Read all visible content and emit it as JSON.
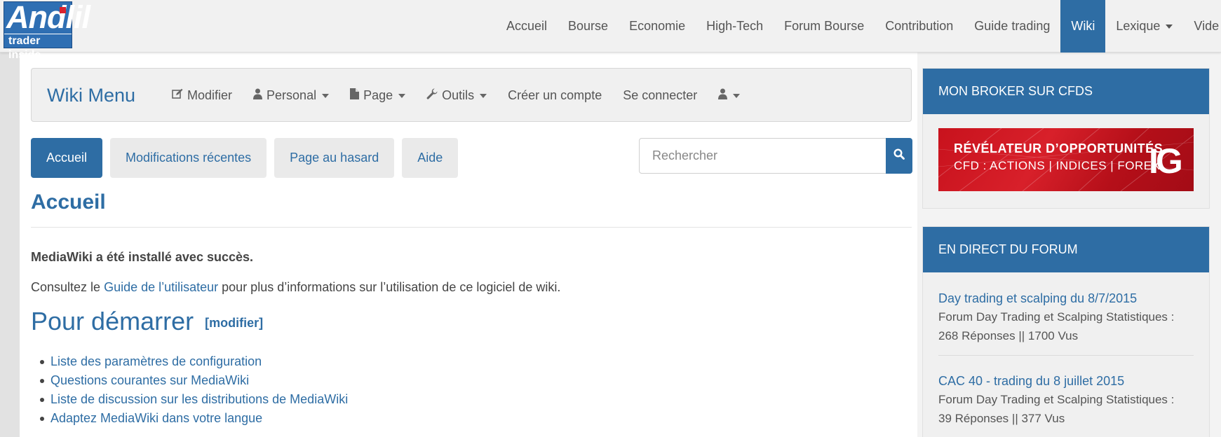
{
  "logo": {
    "main": "Andlil",
    "sub": "trader inside"
  },
  "topnav": {
    "items": [
      "Accueil",
      "Bourse",
      "Economie",
      "High-Tech",
      "Forum Bourse",
      "Contribution",
      "Guide trading",
      "Wiki",
      "Lexique",
      "Vide"
    ]
  },
  "wiki_menu": {
    "brand": "Wiki Menu",
    "modifier": "Modifier",
    "personal": "Personal",
    "page": "Page",
    "outils": "Outils",
    "creer_compte": "Créer un compte",
    "connecter": "Se connecter"
  },
  "tabs": [
    "Accueil",
    "Modifications récentes",
    "Page au hasard",
    "Aide"
  ],
  "search": {
    "placeholder": "Rechercher"
  },
  "content": {
    "title": "Accueil",
    "installed": "MediaWiki a été installé avec succès.",
    "consult_prefix": "Consultez le ",
    "consult_link": "Guide de l’utilisateur",
    "consult_suffix": " pour plus d’informations sur l’utilisation de ce logiciel de wiki.",
    "section_title": "Pour démarrer",
    "section_edit": "[modifier]",
    "links": [
      "Liste des paramètres de configuration",
      "Questions courantes sur MediaWiki",
      "Liste de discussion sur les distributions de MediaWiki",
      "Adaptez MediaWiki dans votre langue"
    ]
  },
  "sidebar": {
    "broker_title": "MON BROKER SUR CFDS",
    "ad_line1": "RÉVÉLATEUR D’OPPORTUNITÉS",
    "ad_line2": "CFD : ACTIONS | INDICES | FOREX",
    "ad_logo": "IG",
    "forum_title": "EN DIRECT DU FORUM",
    "forum_items": [
      {
        "title": "Day trading et scalping du 8/7/2015",
        "meta1": "Forum Day Trading et Scalping Statistiques :",
        "meta2": "268 Réponses || 1700 Vus"
      },
      {
        "title": "CAC 40 - trading du 8 juillet 2015",
        "meta1": "Forum Day Trading et Scalping Statistiques :",
        "meta2": "39 Réponses || 377 Vus"
      }
    ]
  },
  "colors": {
    "brand": "#2e6da4",
    "ad_red": "#c8121d"
  }
}
